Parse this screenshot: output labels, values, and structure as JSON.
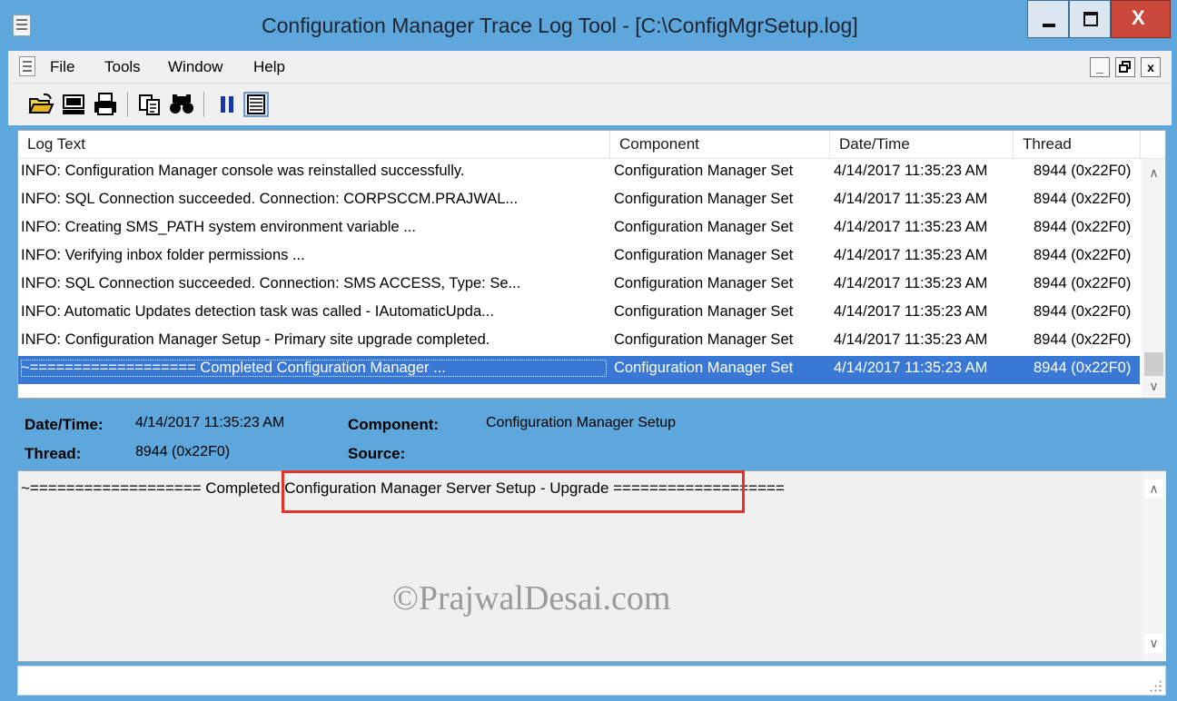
{
  "window": {
    "title": "Configuration Manager Trace Log Tool - [C:\\ConfigMgrSetup.log]",
    "controls": {
      "minimize": "minimize",
      "maximize": "maximize",
      "close": "X"
    }
  },
  "menu": {
    "items": [
      "File",
      "Tools",
      "Window",
      "Help"
    ],
    "mdi": {
      "minimize": "_",
      "restore": "ő",
      "close": "x"
    }
  },
  "toolbar": {
    "tools": [
      "open-icon",
      "computer-icon",
      "print-icon",
      "copy-icon",
      "find-icon",
      "pause-icon",
      "details-icon"
    ]
  },
  "log": {
    "columns": [
      "Log Text",
      "Component",
      "Date/Time",
      "Thread"
    ],
    "rows": [
      {
        "text": "INFO: Configuration Manager console was reinstalled successfully.",
        "component": "Configuration Manager Set",
        "datetime": "4/14/2017 11:35:23 AM",
        "thread": "8944 (0x22F0)"
      },
      {
        "text": "INFO: SQL Connection succeeded. Connection: CORPSCCM.PRAJWAL...",
        "component": "Configuration Manager Set",
        "datetime": "4/14/2017 11:35:23 AM",
        "thread": "8944 (0x22F0)"
      },
      {
        "text": "INFO: Creating SMS_PATH system environment variable ...",
        "component": "Configuration Manager Set",
        "datetime": "4/14/2017 11:35:23 AM",
        "thread": "8944 (0x22F0)"
      },
      {
        "text": "INFO: Verifying inbox folder permissions ...",
        "component": "Configuration Manager Set",
        "datetime": "4/14/2017 11:35:23 AM",
        "thread": "8944 (0x22F0)"
      },
      {
        "text": "INFO: SQL Connection succeeded. Connection: SMS ACCESS, Type: Se...",
        "component": "Configuration Manager Set",
        "datetime": "4/14/2017 11:35:23 AM",
        "thread": "8944 (0x22F0)"
      },
      {
        "text": "INFO: Automatic Updates detection task was called  - IAutomaticUpda...",
        "component": "Configuration Manager Set",
        "datetime": "4/14/2017 11:35:23 AM",
        "thread": "8944 (0x22F0)"
      },
      {
        "text": "INFO: Configuration Manager Setup - Primary site upgrade completed.",
        "component": "Configuration Manager Set",
        "datetime": "4/14/2017 11:35:23 AM",
        "thread": "8944 (0x22F0)"
      },
      {
        "text": "~=================== Completed Configuration Manager ...",
        "component": "Configuration Manager Set",
        "datetime": "4/14/2017 11:35:23 AM",
        "thread": "8944 (0x22F0)"
      }
    ],
    "selected_row_index": 7,
    "scroll": {
      "up": "∧",
      "down": "∨"
    }
  },
  "details": {
    "datetime_label": "Date/Time:",
    "datetime_value": "4/14/2017 11:35:23 AM",
    "component_label": "Component:",
    "component_value": "Configuration Manager Setup",
    "thread_label": "Thread:",
    "thread_value": "8944 (0x22F0)",
    "source_label": "Source:",
    "source_value": ""
  },
  "message": {
    "text": "~=================== Completed Configuration Manager Server Setup - Upgrade ===================",
    "watermark": "©PrajwalDesai.com",
    "scroll": {
      "up": "∧",
      "down": "∨"
    }
  },
  "colors": {
    "titlebar": "#5ea7dc",
    "selection": "#3a78d6",
    "highlight_box": "#e8312a"
  }
}
